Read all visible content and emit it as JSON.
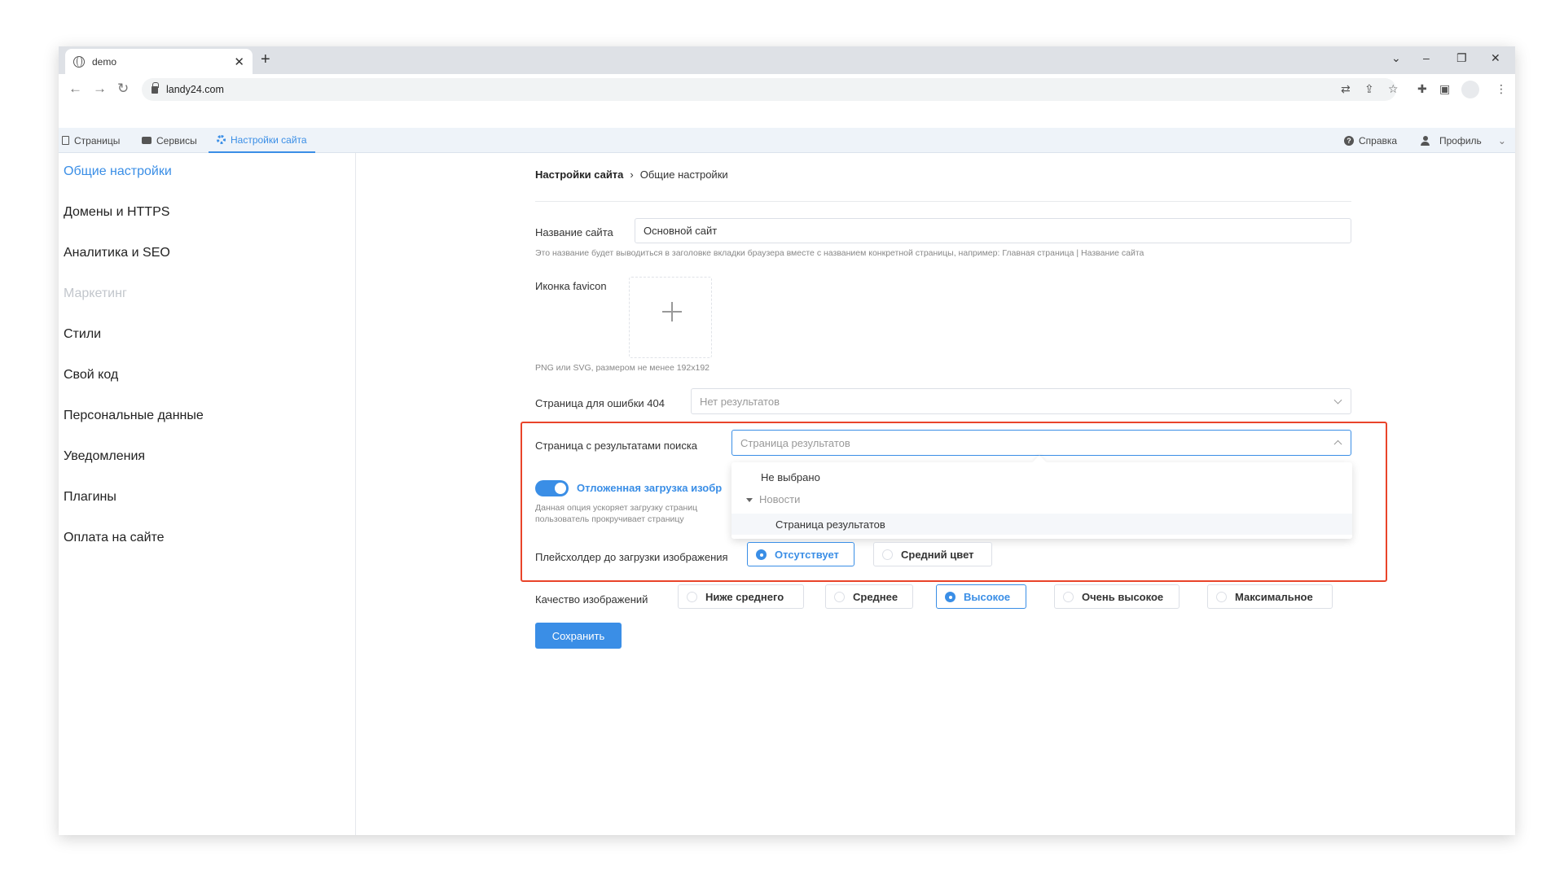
{
  "browser": {
    "tab_title": "demo",
    "url": "landy24.com"
  },
  "appnav": {
    "pages": "Страницы",
    "services": "Сервисы",
    "site_settings": "Настройки сайта",
    "help": "Справка",
    "profile": "Профиль"
  },
  "sidebar": {
    "items": [
      {
        "label": "Общие настройки"
      },
      {
        "label": "Домены и HTTPS"
      },
      {
        "label": "Аналитика и SEO"
      },
      {
        "label": "Маркетинг"
      },
      {
        "label": "Стили"
      },
      {
        "label": "Свой код"
      },
      {
        "label": "Персональные данные"
      },
      {
        "label": "Уведомления"
      },
      {
        "label": "Плагины"
      },
      {
        "label": "Оплата на сайте"
      }
    ]
  },
  "breadcrumb": {
    "root": "Настройки сайта",
    "separator": "›",
    "current": "Общие настройки"
  },
  "form": {
    "site_name_label": "Название сайта",
    "site_name_value": "Основной сайт",
    "site_name_hint": "Это название будет выводиться в заголовке вкладки браузера вместе с названием конкретной страницы, например: Главная страница | Название сайта",
    "favicon_label": "Иконка favicon",
    "favicon_hint": "PNG или SVG, размером не менее 192x192",
    "error404_label": "Страница для ошибки 404",
    "error404_placeholder": "Нет результатов",
    "search_page_label": "Страница с результатами поиска",
    "search_page_placeholder": "Страница результатов",
    "lazy_load_label": "Отложенная загрузка изобр",
    "lazy_load_hint_1": "Данная опция ускоряет загрузку страниц",
    "lazy_load_hint_2": "пользователь прокручивает страницу",
    "placeholder_label": "Плейсхолдер до загрузки изображения",
    "placeholder_options": [
      "Отсутствует",
      "Средний цвет"
    ],
    "quality_label": "Качество изображений",
    "quality_options": [
      "Ниже среднего",
      "Среднее",
      "Высокое",
      "Очень высокое",
      "Максимальное"
    ],
    "save_label": "Сохранить"
  },
  "dropdown": {
    "none": "Не выбрано",
    "group": "Новости",
    "selected": "Страница результатов"
  },
  "colors": {
    "accent": "#3a8ee6",
    "highlight": "#e9442a"
  }
}
